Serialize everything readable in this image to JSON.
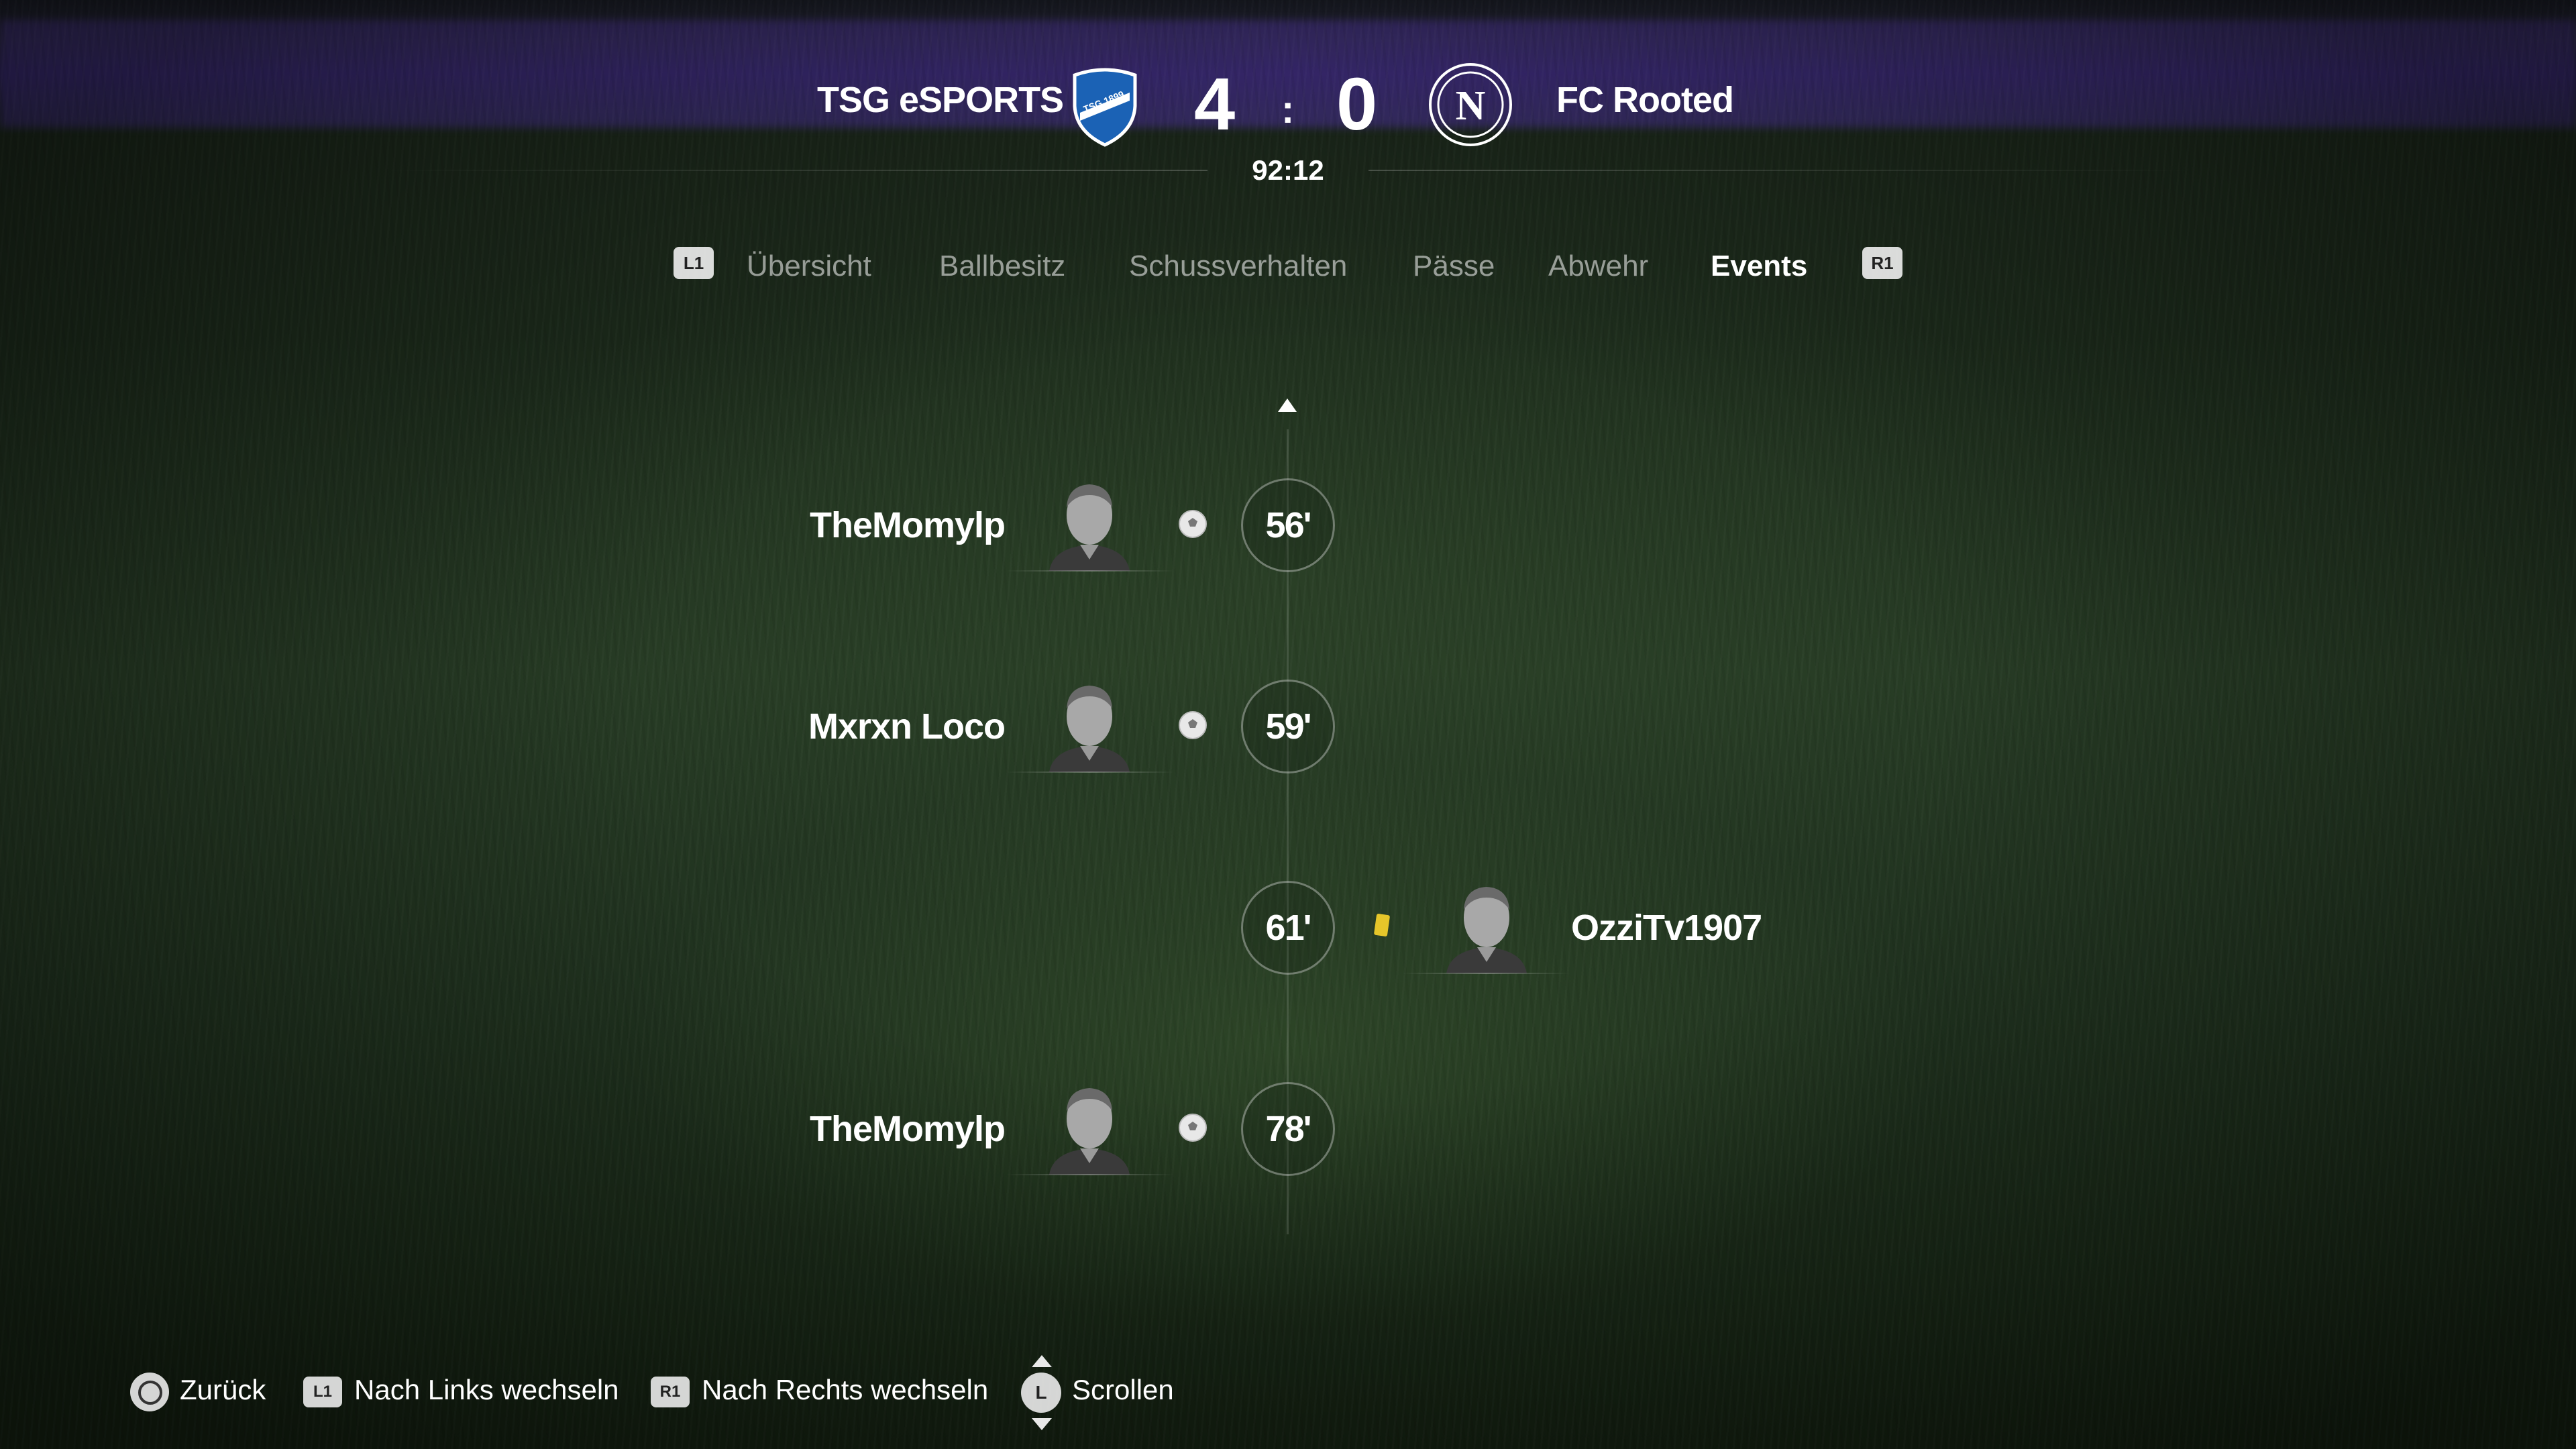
{
  "scoreboard": {
    "home_team": "TSG eSPORTS",
    "away_team": "FC Rooted",
    "home_score": "4",
    "separator": ":",
    "away_score": "0",
    "clock": "92:12",
    "home_crest_text": "TSG 1899",
    "away_crest_letter": "N"
  },
  "tabs": {
    "left_button": "L1",
    "right_button": "R1",
    "items": [
      {
        "label": "Übersicht",
        "active": false
      },
      {
        "label": "Ballbesitz",
        "active": false
      },
      {
        "label": "Schussverhalten",
        "active": false
      },
      {
        "label": "Pässe",
        "active": false
      },
      {
        "label": "Abwehr",
        "active": false
      },
      {
        "label": "Events",
        "active": true
      }
    ]
  },
  "events": [
    {
      "minute": "56'",
      "side": "home",
      "player": "TheMomylp",
      "type": "goal-icon"
    },
    {
      "minute": "59'",
      "side": "home",
      "player": "Mxrxn Loco",
      "type": "goal-icon"
    },
    {
      "minute": "61'",
      "side": "away",
      "player": "OzziTv1907",
      "type": "yellow-card-icon"
    },
    {
      "minute": "78'",
      "side": "home",
      "player": "TheMomylp",
      "type": "goal-icon"
    }
  ],
  "controls": {
    "back": "Zurück",
    "l1_badge": "L1",
    "left_switch": "Nach Links wechseln",
    "r1_badge": "R1",
    "right_switch": "Nach Rechts wechseln",
    "stick_badge": "L",
    "scroll": "Scrollen"
  },
  "colors": {
    "yellow_card": "#e6c62a",
    "home_crest": "#1b62b5",
    "banner": "#4b3a9a"
  }
}
